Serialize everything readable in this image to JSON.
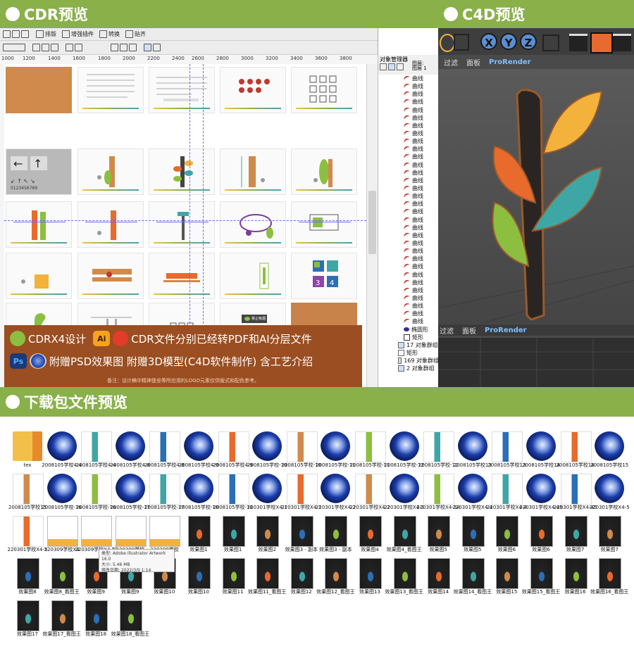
{
  "sections": {
    "cdr_title": "CDR预览",
    "c4d_title": "C4D预览",
    "download_title": "下载包文件预览"
  },
  "cdr": {
    "toolbar_items": [
      "排版",
      "增强插件",
      "转换",
      "贴齐"
    ],
    "ruler_ticks": [
      "1000",
      "1200",
      "1400",
      "1600",
      "1800",
      "2000",
      "2200",
      "2400",
      "2600",
      "2800",
      "3000",
      "3200",
      "3400",
      "3600",
      "3800"
    ],
    "thumb_texts": {
      "arrows_caption": "0123456789",
      "sign_text": "禁止吸烟"
    },
    "object_manager": {
      "title": "对象管理器",
      "page_label": "图层 1",
      "layer_label": "图层:",
      "curve_label": "曲线",
      "curve_count": 32,
      "ellipse_label": "椭圆形",
      "rect_label": "矩形",
      "groups": [
        "17 对象群组",
        "矩形",
        "169 对象群组",
        "2 对象群组"
      ]
    },
    "ad": {
      "line1_cdr": "CDRX4设计",
      "line1_ai_badge": "Ai",
      "line1_text": "CDR文件分别已经转PDF和AI分层文件",
      "line2_ps_badge": "Ps",
      "line2_text": "附赠PSD效果图 附赠3D模型(C4D软件制作) 含工艺介绍",
      "note": "备注：设计稿中精神堡垒等所应用的LOGO元素仅供版式和配色参考。"
    }
  },
  "c4d": {
    "axis_buttons": [
      "X",
      "Y",
      "Z"
    ],
    "menu_top": [
      "过滤",
      "面板",
      "ProRender"
    ],
    "menu_bottom": [
      "过滤",
      "面板",
      "ProRender"
    ]
  },
  "files": [
    {
      "name": "tex",
      "type": "folder"
    },
    {
      "name": "2008105学校4-4",
      "type": "c4d"
    },
    {
      "name": "2008105学校4-4",
      "type": "img"
    },
    {
      "name": "2008105学校4-8",
      "type": "c4d"
    },
    {
      "name": "2008105学校4-8",
      "type": "img"
    },
    {
      "name": "2008105学校4-9",
      "type": "c4d"
    },
    {
      "name": "2008105学校4-9",
      "type": "img"
    },
    {
      "name": "2008105学校-10",
      "type": "c4d"
    },
    {
      "name": "2008105学校-10",
      "type": "img"
    },
    {
      "name": "2008105学校-11",
      "type": "c4d"
    },
    {
      "name": "2008105学校-11",
      "type": "img"
    },
    {
      "name": "2008105学校-12",
      "type": "c4d"
    },
    {
      "name": "2008105学校-12",
      "type": "img"
    },
    {
      "name": "2008105学校13",
      "type": "c4d"
    },
    {
      "name": "2008105学校13",
      "type": "img"
    },
    {
      "name": "2008105学校14",
      "type": "c4d"
    },
    {
      "name": "2008105学校14",
      "type": "img"
    },
    {
      "name": "2008105学校15",
      "type": "c4d"
    },
    {
      "name": "2008105学校15",
      "type": "img"
    },
    {
      "name": "2008105学校-16",
      "type": "c4d"
    },
    {
      "name": "2008105学校-16",
      "type": "img"
    },
    {
      "name": "2008105学校-17",
      "type": "c4d"
    },
    {
      "name": "2008105学校-17",
      "type": "img"
    },
    {
      "name": "2008105学校-18",
      "type": "c4d"
    },
    {
      "name": "2008105学校-18",
      "type": "img"
    },
    {
      "name": "220301学校X4-1",
      "type": "c4d"
    },
    {
      "name": "220301学校X4-1",
      "type": "img"
    },
    {
      "name": "220301学校X4-2",
      "type": "c4d"
    },
    {
      "name": "220301学校X4-2",
      "type": "img"
    },
    {
      "name": "220301学校X4-3",
      "type": "c4d"
    },
    {
      "name": "220301学校X4-3A",
      "type": "img"
    },
    {
      "name": "220301学校X4-4",
      "type": "c4d"
    },
    {
      "name": "220301学校X4-4",
      "type": "img"
    },
    {
      "name": "220301学校X4-45",
      "type": "c4d"
    },
    {
      "name": "220301学校X4-45",
      "type": "img"
    },
    {
      "name": "220301学校X4-5",
      "type": "c4d"
    },
    {
      "name": "220301学校X4-5",
      "type": "img"
    },
    {
      "name": "220309学校X4",
      "type": "doc"
    },
    {
      "name": "220309学校X4-标",
      "type": "doc"
    },
    {
      "name": "220309学校",
      "type": "doc"
    },
    {
      "name": "220309学校",
      "type": "doc"
    },
    {
      "name": "效果图1",
      "type": "render"
    },
    {
      "name": "效果图1",
      "type": "render"
    },
    {
      "name": "效果图2",
      "type": "render"
    },
    {
      "name": "效果图3 - 副本",
      "type": "render"
    },
    {
      "name": "效果图3 - 副本",
      "type": "render"
    },
    {
      "name": "效果图4",
      "type": "render"
    },
    {
      "name": "效果图4_看图王",
      "type": "render"
    },
    {
      "name": "效果图5",
      "type": "render"
    },
    {
      "name": "效果图5",
      "type": "render"
    },
    {
      "name": "效果图6",
      "type": "render"
    },
    {
      "name": "效果图6",
      "type": "render"
    },
    {
      "name": "效果图7",
      "type": "render"
    },
    {
      "name": "效果图7",
      "type": "render"
    },
    {
      "name": "效果图8",
      "type": "render"
    },
    {
      "name": "效果图8_看图王",
      "type": "render"
    },
    {
      "name": "效果图9",
      "type": "render"
    },
    {
      "name": "效果图9",
      "type": "render"
    },
    {
      "name": "效果图10",
      "type": "render"
    },
    {
      "name": "效果图10",
      "type": "render"
    },
    {
      "name": "效果图11",
      "type": "render"
    },
    {
      "name": "效果图11_看图王",
      "type": "render"
    },
    {
      "name": "效果图12",
      "type": "render"
    },
    {
      "name": "效果图12_看图王",
      "type": "render"
    },
    {
      "name": "效果图13",
      "type": "render"
    },
    {
      "name": "效果图13_看图王",
      "type": "render"
    },
    {
      "name": "效果图14",
      "type": "render"
    },
    {
      "name": "效果图14_看图王",
      "type": "render"
    },
    {
      "name": "效果图15",
      "type": "render"
    },
    {
      "name": "效果图15_看图王",
      "type": "render"
    },
    {
      "name": "效果图16",
      "type": "render"
    },
    {
      "name": "效果图16_看图王",
      "type": "render"
    },
    {
      "name": "效果图17",
      "type": "render"
    },
    {
      "name": "效果图17_看图王",
      "type": "render"
    },
    {
      "name": "效果图18",
      "type": "render"
    },
    {
      "name": "效果图18_看图王",
      "type": "render"
    }
  ],
  "tooltip": {
    "type": "类型: Adobe Illustrator Artwork 16.0",
    "size": "大小: 5.46 MB",
    "modified": "修改日期: 2022/3/9 1:14"
  },
  "colors": {
    "banner_green": "#8ab04a",
    "ad_brown": "#9a4e21",
    "leaf_orange": "#e86a2c",
    "leaf_yellow": "#f2b23c",
    "leaf_teal": "#3fa6a6",
    "leaf_green": "#8cbf3f"
  }
}
